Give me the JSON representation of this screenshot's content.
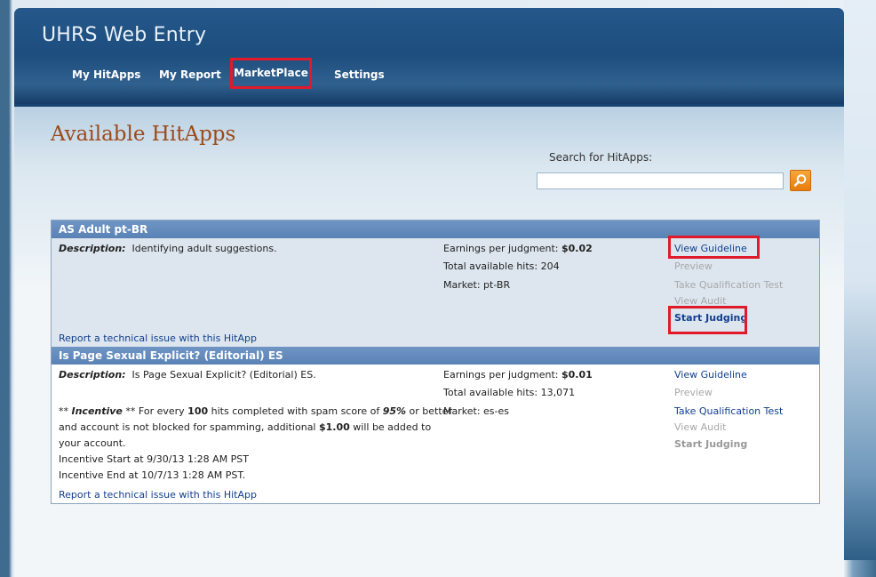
{
  "app": {
    "title": "UHRS Web Entry"
  },
  "nav": {
    "items": [
      {
        "label": "My HitApps"
      },
      {
        "label": "My Report"
      },
      {
        "label": "MarketPlace"
      },
      {
        "label": "Settings"
      }
    ],
    "selected": "MarketPlace"
  },
  "page": {
    "title": "Available HitApps"
  },
  "search": {
    "label": "Search for HitApps:",
    "value": "",
    "button_icon": "search-icon"
  },
  "hitapps": [
    {
      "name": "AS Adult pt-BR",
      "description_label": "Description:",
      "description": "Identifying adult suggestions.",
      "earnings_label": "Earnings per judgment:",
      "earnings": "$0.02",
      "hits_label": "Total available hits:",
      "hits": "204",
      "market_label": "Market:",
      "market": "pt-BR",
      "actions": {
        "view_guideline": "View Guideline",
        "preview": "Preview",
        "take_qualification": "Take Qualification Test",
        "view_audit": "View Audit",
        "start_judging": "Start Judging"
      },
      "report": "Report a technical issue with this HitApp"
    },
    {
      "name": "Is Page Sexual Explicit? (Editorial) ES",
      "description_label": "Description:",
      "description": "Is Page Sexual Explicit? (Editorial) ES.",
      "earnings_label": "Earnings per judgment:",
      "earnings": "$0.01",
      "hits_label": "Total available hits:",
      "hits": "13,071",
      "market_label": "Market:",
      "market": "es-es",
      "incentive": {
        "prefix": "** ",
        "label": "Incentive",
        "suffix": " **",
        "t1": " For every ",
        "hits": "100",
        "t2": " hits completed with spam score of ",
        "score": "95%",
        "t3": " or better",
        "line2a": "and account is not blocked for spamming, additional ",
        "amount": "$1.00",
        "line2b": " will be added to",
        "line3": "your account.",
        "start": "Incentive Start at 9/30/13 1:28 AM PST",
        "end": "Incentive End at 10/7/13 1:28 AM PST."
      },
      "actions": {
        "view_guideline": "View Guideline",
        "preview": "Preview",
        "take_qualification": "Take Qualification Test",
        "view_audit": "View Audit",
        "start_judging": "Start Judging"
      },
      "report": "Report a technical issue with this HitApp"
    }
  ],
  "colors": {
    "highlight_box": "#e01a2a",
    "link": "#123f8e",
    "page_title": "#9b4a1c"
  }
}
